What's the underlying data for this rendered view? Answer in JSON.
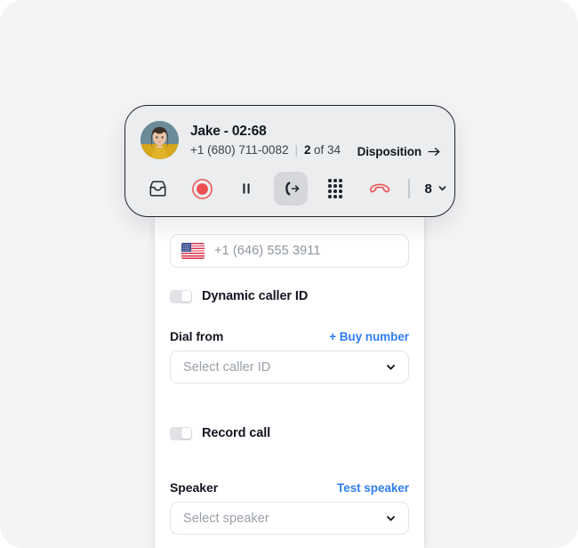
{
  "call_bar": {
    "avatar_name": "contact-avatar",
    "contact_name": "Jake  - 02:68",
    "phone_number": "+1 (680) 711-0082",
    "separator": "|",
    "queue_current": "2",
    "queue_rest": "of 34",
    "disposition_label": "Disposition",
    "volume_level": "8",
    "controls": [
      {
        "name": "inbox-icon",
        "label": "Inbox"
      },
      {
        "name": "record-icon",
        "label": "Record"
      },
      {
        "name": "pause-icon",
        "label": "Pause"
      },
      {
        "name": "transfer-call-icon",
        "label": "Transfer call"
      },
      {
        "name": "dialpad-icon",
        "label": "Dialpad"
      },
      {
        "name": "hang-up-icon",
        "label": "Hang up"
      }
    ],
    "colors": {
      "record_red": "#ee4d52",
      "hangup_red": "#ee4d52",
      "bar_bg": "#ebedee",
      "bar_border": "#20242e",
      "active_ctl_bg": "#d5d7da"
    }
  },
  "settings_panel": {
    "phone_input": {
      "placeholder": "+1 (646) 555 3911",
      "country_flag": "us-flag-icon"
    },
    "dynamic_caller_id": {
      "label": "Dynamic caller ID",
      "enabled": false
    },
    "dial_from": {
      "label": "Dial from",
      "link_label": "+ Buy number",
      "select_value": "Select caller ID"
    },
    "record_call": {
      "label": "Record call",
      "enabled": false
    },
    "speaker": {
      "label": "Speaker",
      "link_label": "Test speaker",
      "select_value": "Select speaker"
    },
    "colors": {
      "link_blue": "#2f7df6",
      "panel_bg": "#ffffff",
      "border": "#e3e5e8",
      "placeholder": "#8e949d"
    }
  },
  "page": {
    "background": "#f4f4f5"
  }
}
